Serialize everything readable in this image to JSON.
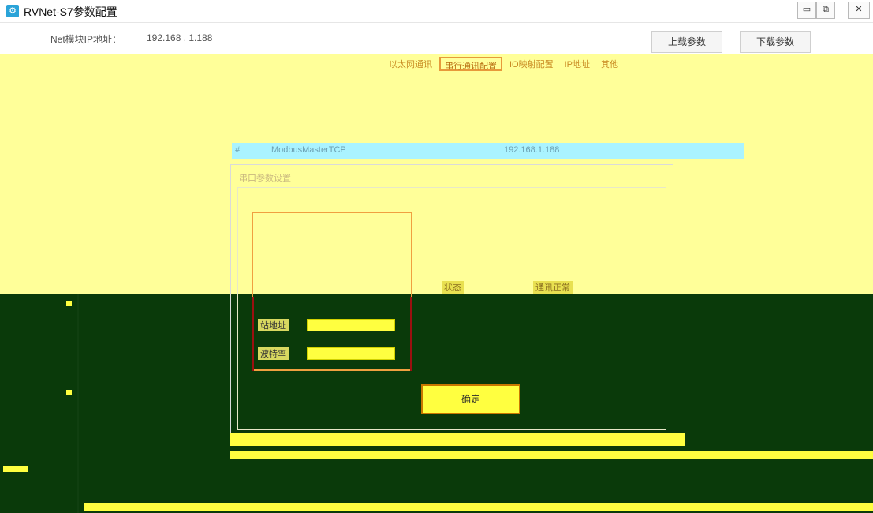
{
  "window": {
    "title": "RVNet-S7参数配置",
    "minimize_symbol": "▭",
    "maximize_symbol": "⧉",
    "close_symbol": "✕",
    "icon": "gear-icon"
  },
  "toolbar": {
    "ip_label": "Net模块IP地址：",
    "ip_value": "192.168 . 1.188",
    "upload_label": "上载参数",
    "download_label": "下载参数"
  },
  "tabs": [
    {
      "label": "以太网通讯",
      "active": false
    },
    {
      "label": "串行通讯配置",
      "active": true
    },
    {
      "label": "IO映射配置",
      "active": false
    },
    {
      "label": "IP地址",
      "active": false
    },
    {
      "label": "其他",
      "active": false
    }
  ],
  "table": {
    "col0": "#",
    "col1": "ModbusMasterTCP",
    "col2": "192.168.1.188"
  },
  "dialog": {
    "title": "串口参数设置"
  },
  "form": {
    "row1_label": "站地址",
    "row2_label": "波特率",
    "stat_a": "状态",
    "stat_b": "通讯正常"
  },
  "buttons": {
    "ok": "确定"
  },
  "colors": {
    "accent_yellow": "#ffff99",
    "dark_green": "#0a3a0a",
    "orange_border": "#f0a040",
    "header_cyan": "#aaf3ff"
  }
}
